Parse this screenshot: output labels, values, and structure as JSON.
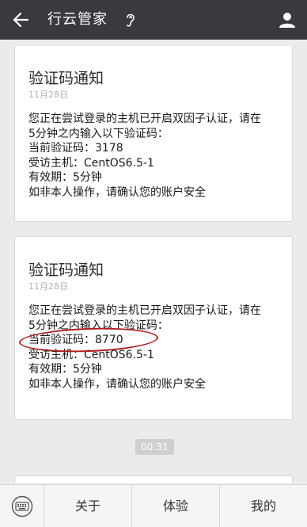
{
  "header": {
    "title": "行云管家"
  },
  "messages": [
    {
      "title": "验证码通知",
      "date": "11月28日",
      "lines": [
        "您正在尝试登录的主机已开启双因子认证，请在",
        "5分钟之内输入以下验证码：",
        "当前验证码：3178",
        "受访主机：CentOS6.5-1",
        "有效期：5分钟",
        "如非本人操作，请确认您的账户安全"
      ]
    },
    {
      "title": "验证码通知",
      "date": "11月28日",
      "lines": [
        "您正在尝试登录的主机已开启双因子认证，请在",
        "5分钟之内输入以下验证码：",
        "当前验证码：8770",
        "受访主机：CentOS6.5-1",
        "有效期：5分钟",
        "如非本人操作，请确认您的账户安全"
      ]
    }
  ],
  "time_badge": "00:31",
  "bottom_menu": {
    "items": [
      "关于",
      "体验",
      "我的"
    ]
  },
  "icons": {
    "back": "back-arrow-icon",
    "listen": "ear-icon",
    "profile": "person-icon",
    "keyboard": "keyboard-icon"
  },
  "colors": {
    "header_bg": "#393a3f",
    "highlight": "#b11e1e",
    "page_bg": "#ebebeb"
  }
}
